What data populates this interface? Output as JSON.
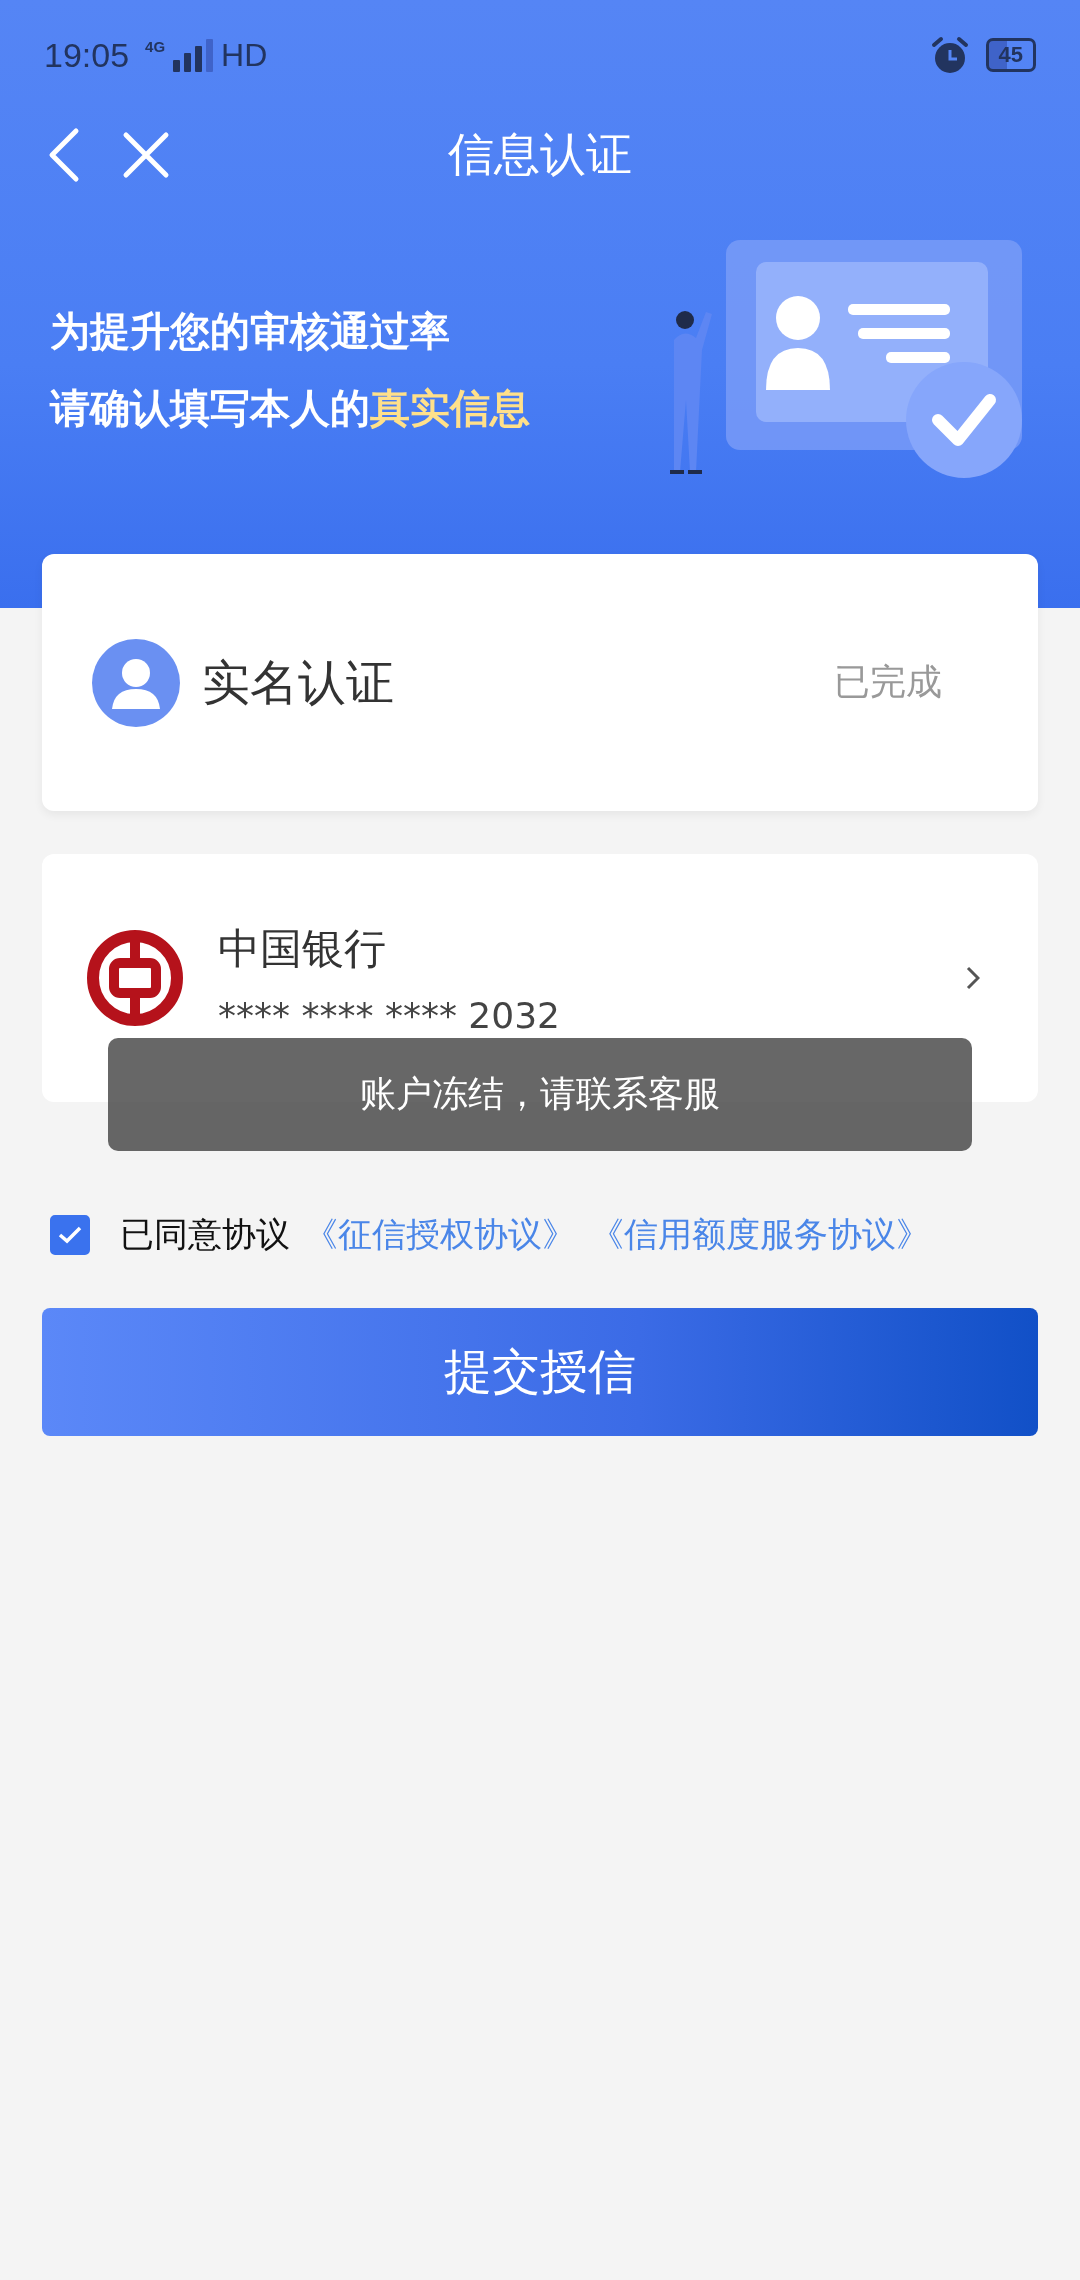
{
  "status_bar": {
    "time": "19:05",
    "network": "4G",
    "hd": "HD",
    "battery": "45"
  },
  "header": {
    "title": "信息认证"
  },
  "banner": {
    "line_1": "为提升您的审核通过率",
    "line_2": "请确认填写本人的",
    "line_2_highlight": "真实信息"
  },
  "identity_card": {
    "title": "实名认证",
    "status": "已完成"
  },
  "bank_card": {
    "bank_name": "中国银行",
    "card_number": "**** **** **** 2032"
  },
  "toast": {
    "message": "账户冻结，请联系客服"
  },
  "agreement": {
    "checked": true,
    "label": "已同意协议",
    "links": [
      "《征信授权协议》",
      "《信用额度服务协议》"
    ]
  },
  "submit_button": {
    "label": "提交授信"
  }
}
